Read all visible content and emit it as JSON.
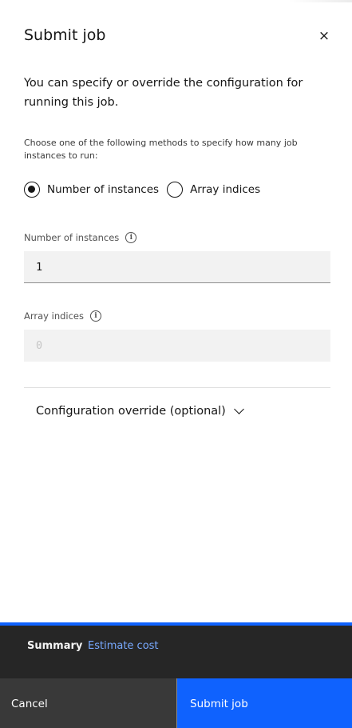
{
  "panel": {
    "title": "Submit job",
    "close_icon": "×",
    "description": "You can specify or override the configuration for running this job.",
    "method_hint": "Choose one of the following methods to specify how many job instances to run:"
  },
  "method": {
    "options": [
      {
        "label": "Number of instances",
        "checked": true
      },
      {
        "label": "Array indices",
        "checked": false
      }
    ]
  },
  "instances_field": {
    "label": "Number of instances",
    "info_icon": "i",
    "value": "1"
  },
  "array_field": {
    "label": "Array indices",
    "info_icon": "i",
    "placeholder": "0"
  },
  "config_override": {
    "label": "Configuration override (optional)"
  },
  "footer": {
    "summary_title": "Summary",
    "estimate_link": "Estimate cost",
    "cancel_label": "Cancel",
    "submit_label": "Submit job"
  },
  "colors": {
    "accent": "#0f62fe",
    "footer_bg": "#262626",
    "cancel_bg": "#393939",
    "link": "#78a9ff"
  }
}
